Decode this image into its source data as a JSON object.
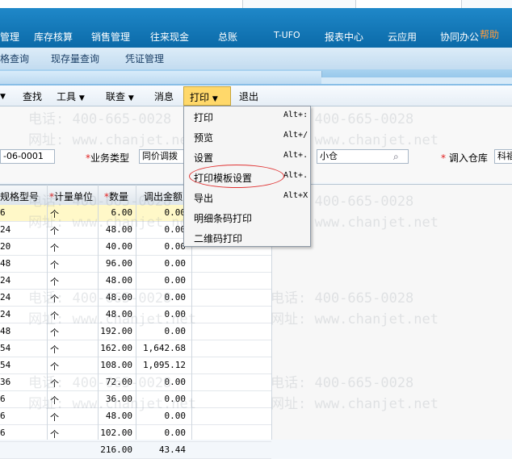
{
  "main_menu": [
    "管理",
    "库存核算",
    "销售管理",
    "往来现金",
    "总账",
    "T-UFO",
    "报表中心",
    "云应用",
    "协同办公"
  ],
  "help_label": "帮助",
  "sub_menu": [
    "格查询",
    "现存量查询",
    "凭证管理"
  ],
  "toolbar": {
    "find": "查找",
    "tools": "工具",
    "query": "联查",
    "message": "消息",
    "print": "打印",
    "exit": "退出"
  },
  "form": {
    "code_value": "-06-0001",
    "biz_type_label": "业务类型",
    "biz_type_value": "同价调拨",
    "out_wh_value": "小仓",
    "in_wh_label": "调入仓库",
    "in_wh_value": "科福"
  },
  "grid": {
    "headers": [
      "规格型号",
      "计量单位",
      "数量",
      "调出金额"
    ],
    "rows": [
      {
        "spec": "6",
        "unit": "个",
        "qty": "6.00",
        "amt": "0.00"
      },
      {
        "spec": "24",
        "unit": "个",
        "qty": "48.00",
        "amt": "0.00"
      },
      {
        "spec": "20",
        "unit": "个",
        "qty": "40.00",
        "amt": "0.00"
      },
      {
        "spec": "48",
        "unit": "个",
        "qty": "96.00",
        "amt": "0.00"
      },
      {
        "spec": "24",
        "unit": "个",
        "qty": "48.00",
        "amt": "0.00"
      },
      {
        "spec": "24",
        "unit": "个",
        "qty": "48.00",
        "amt": "0.00"
      },
      {
        "spec": "24",
        "unit": "个",
        "qty": "48.00",
        "amt": "0.00"
      },
      {
        "spec": "48",
        "unit": "个",
        "qty": "192.00",
        "amt": "0.00"
      },
      {
        "spec": "54",
        "unit": "个",
        "qty": "162.00",
        "amt": "1,642.68"
      },
      {
        "spec": "54",
        "unit": "个",
        "qty": "108.00",
        "amt": "1,095.12"
      },
      {
        "spec": "36",
        "unit": "个",
        "qty": "72.00",
        "amt": "0.00"
      },
      {
        "spec": "6",
        "unit": "个",
        "qty": "36.00",
        "amt": "0.00"
      },
      {
        "spec": "6",
        "unit": "个",
        "qty": "48.00",
        "amt": "0.00"
      },
      {
        "spec": "6",
        "unit": "个",
        "qty": "102.00",
        "amt": "0.00"
      },
      {
        "spec": "",
        "unit": "",
        "qty": "216.00",
        "amt": "43.44"
      }
    ]
  },
  "print_menu": {
    "items": [
      {
        "label": "打印",
        "shortcut": "Alt+:"
      },
      {
        "label": "预览",
        "shortcut": "Alt+/"
      },
      {
        "label": "设置",
        "shortcut": "Alt+."
      },
      {
        "label": "打印模板设置",
        "shortcut": "Alt+."
      },
      {
        "label": "导出",
        "shortcut": "Alt+X"
      },
      {
        "label": "明细条码打印",
        "shortcut": ""
      },
      {
        "label": "二维码打印",
        "shortcut": ""
      }
    ]
  },
  "watermark": {
    "phone": "电话: 400-665-0028",
    "site": "网址: www.chanjet.net"
  },
  "colors": {
    "menu_bar": "#1479bb",
    "highlight_row": "#fff8c8",
    "print_active": "#ffd86a",
    "annotation_ellipse": "#e03333",
    "help_text": "#ff9a3c"
  }
}
